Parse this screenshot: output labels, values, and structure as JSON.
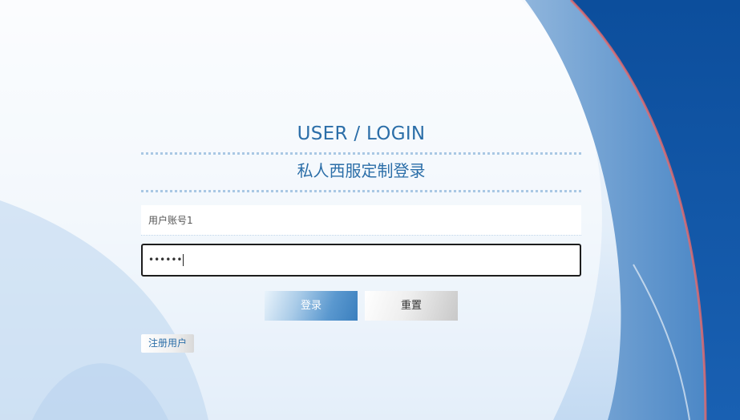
{
  "login": {
    "title_en": "USER / LOGIN",
    "title_cn": "私人西服定制登录",
    "username_value": "用户账号1",
    "password_masked": "••••••",
    "login_button": "登录",
    "reset_button": "重置",
    "register_button": "注册用户"
  },
  "colors": {
    "accent": "#2b6ea8",
    "background_blue": "#0b4f9e",
    "panel_light": "#e8f2fb"
  }
}
